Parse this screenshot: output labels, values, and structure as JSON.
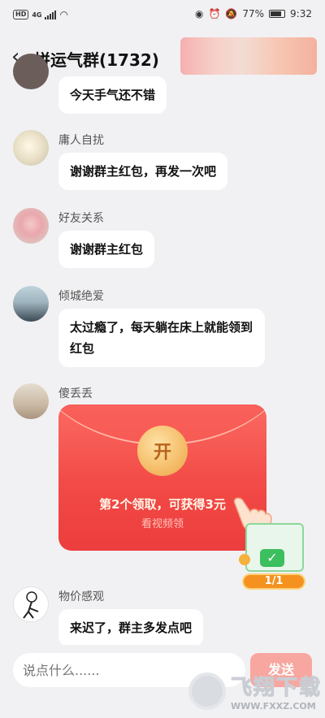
{
  "status_bar": {
    "hd": "HD",
    "network": "4G",
    "battery": "77%",
    "time": "9:32"
  },
  "header": {
    "back_icon": "chevron-left-icon",
    "title": "拼运气群(1732)"
  },
  "messages": [
    {
      "name": "",
      "text": "今天手气还不错"
    },
    {
      "name": "庸人自扰",
      "text": "谢谢群主红包，再发一次吧"
    },
    {
      "name": "好友关系",
      "text": "谢谢群主红包"
    },
    {
      "name": "倾城绝爱",
      "text": "太过瘾了，每天躺在床上就能领到红包"
    },
    {
      "name": "傻丢丢",
      "text": ""
    },
    {
      "name": "物价感观",
      "text": "来迟了，群主多发点吧"
    }
  ],
  "red_packet": {
    "open_label": "开",
    "claim_text": "第2个领取，可获得3元",
    "sub_text": "看视频领"
  },
  "widget": {
    "progress": "1/1"
  },
  "input_bar": {
    "placeholder": "说点什么......",
    "send_label": "发送"
  },
  "watermark": {
    "title": "飞翔下载",
    "url": "WWW.FXXZ.COM"
  },
  "colors": {
    "background": "#f1f1f3",
    "packet_red": "#f24a46",
    "send_pink": "#f7a7a0",
    "widget_orange": "#f4911f"
  }
}
